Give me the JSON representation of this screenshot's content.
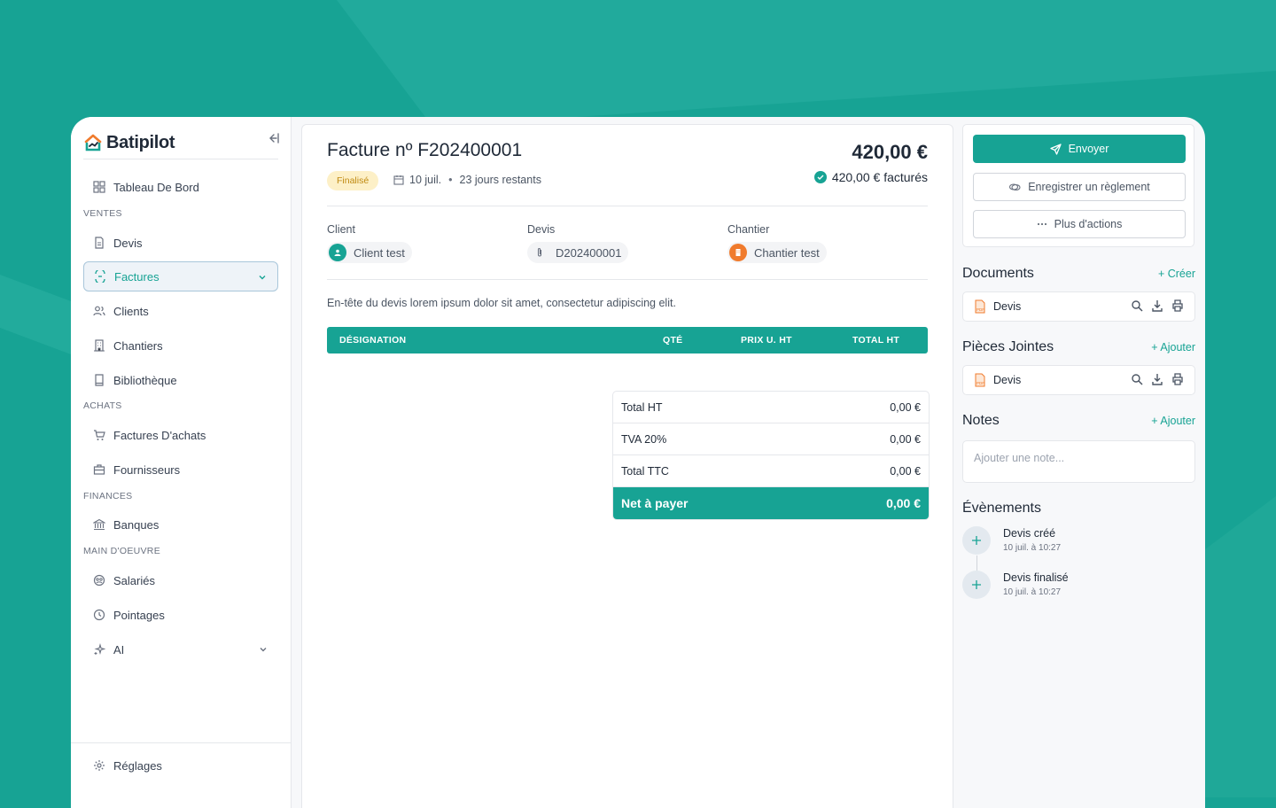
{
  "app": {
    "name": "Batipilot",
    "brand_color": "#17a394"
  },
  "sidebar": {
    "items": {
      "dashboard": "Tableau De Bord",
      "devis": "Devis",
      "factures": "Factures",
      "clients": "Clients",
      "chantiers": "Chantiers",
      "bibliotheque": "Bibliothèque",
      "factures_achats": "Factures D'achats",
      "fournisseurs": "Fournisseurs",
      "banques": "Banques",
      "salaries": "Salariés",
      "pointages": "Pointages",
      "ai": "AI",
      "reglages": "Réglages"
    },
    "sections": {
      "ventes": "VENTES",
      "achats": "ACHATS",
      "finances": "FINANCES",
      "main_oeuvre": "MAIN D'OEUVRE"
    }
  },
  "invoice": {
    "title": "Facture nº F202400001",
    "status": "Finalisé",
    "date": "10 juil.",
    "days_left": "23 jours restants",
    "total": "420,00 €",
    "billed": "420,00 € facturés",
    "client_label": "Client",
    "client_value": "Client test",
    "devis_label": "Devis",
    "devis_value": "D202400001",
    "chantier_label": "Chantier",
    "chantier_value": "Chantier test",
    "header_text": "En-tête du devis lorem ipsum dolor sit amet, consectetur adipiscing elit.",
    "columns": {
      "designation": "DÉSIGNATION",
      "qty": "QTÉ",
      "unit_price": "PRIX U. HT",
      "total_ht": "TOTAL HT"
    },
    "totals": [
      {
        "label": "Total HT",
        "value": "0,00 €"
      },
      {
        "label": "TVA 20%",
        "value": "0,00 €"
      },
      {
        "label": "Total TTC",
        "value": "0,00 €"
      }
    ],
    "net": {
      "label": "Net à payer",
      "value": "0,00 €"
    }
  },
  "actions": {
    "send": "Envoyer",
    "record_payment": "Enregistrer un règlement",
    "more": "Plus d'actions"
  },
  "documents": {
    "title": "Documents",
    "create": "+ Créer",
    "items": [
      "Devis"
    ]
  },
  "attachments": {
    "title": "Pièces Jointes",
    "add": "+ Ajouter",
    "items": [
      "Devis"
    ]
  },
  "notes": {
    "title": "Notes",
    "add": "+ Ajouter",
    "placeholder": "Ajouter une note..."
  },
  "events": {
    "title": "Évènements",
    "items": [
      {
        "title": "Devis créé",
        "time": "10 juil. à 10:27"
      },
      {
        "title": "Devis finalisé",
        "time": "10 juil. à 10:27"
      }
    ]
  }
}
